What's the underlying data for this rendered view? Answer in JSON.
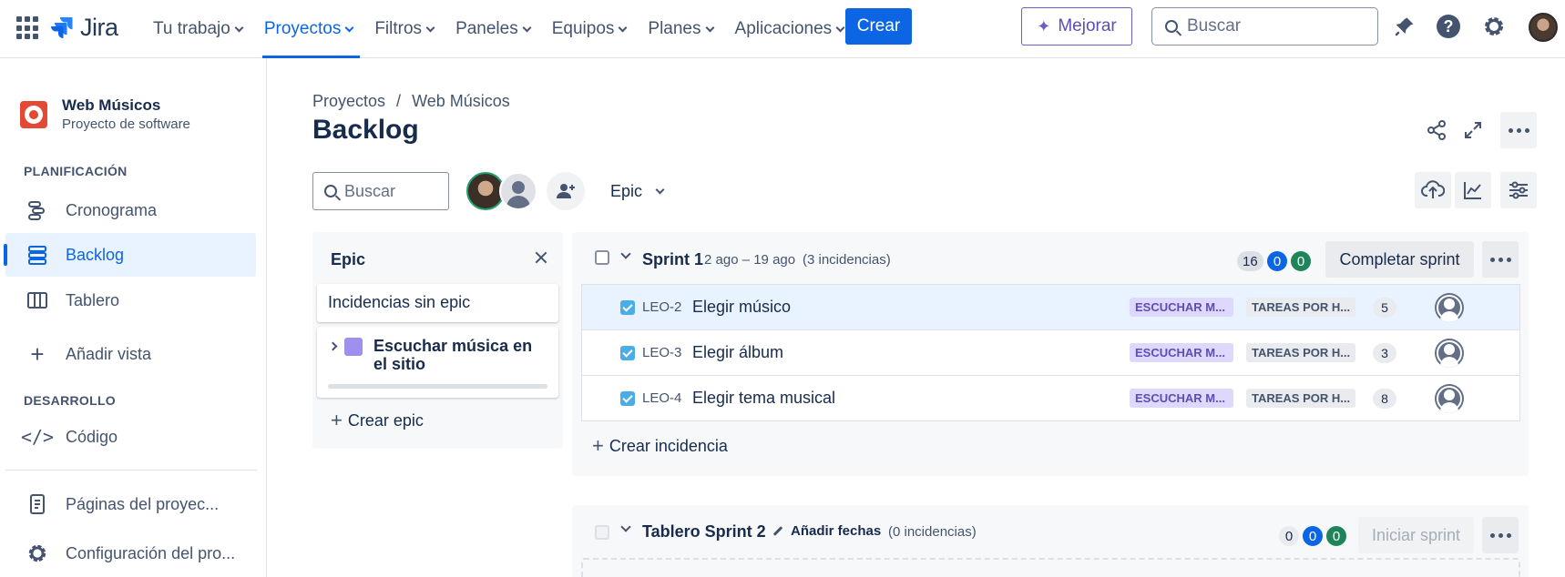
{
  "topnav": {
    "logo": "Jira",
    "items": [
      {
        "label": "Tu trabajo"
      },
      {
        "label": "Proyectos"
      },
      {
        "label": "Filtros"
      },
      {
        "label": "Paneles"
      },
      {
        "label": "Equipos"
      },
      {
        "label": "Planes"
      },
      {
        "label": "Aplicaciones"
      }
    ],
    "active_item": "Proyectos",
    "create_label": "Crear",
    "improve_label": "Mejorar",
    "search_placeholder": "Buscar",
    "icons": [
      "notifications-icon",
      "help-icon",
      "settings-icon",
      "avatar"
    ]
  },
  "sidebar": {
    "project_name": "Web Músicos",
    "project_type": "Proyecto de software",
    "planning_heading": "PLANIFICACIÓN",
    "planning_items": [
      {
        "label": "Cronograma",
        "icon": "timeline-icon"
      },
      {
        "label": "Backlog",
        "icon": "backlog-icon"
      },
      {
        "label": "Tablero",
        "icon": "board-icon"
      }
    ],
    "active_item": "Backlog",
    "add_view": "Añadir vista",
    "dev_heading": "DESARROLLO",
    "code_label": "Código",
    "project_pages": "Páginas del proyec...",
    "project_settings": "Configuración del pro..."
  },
  "header": {
    "breadcrumb": [
      "Proyectos",
      "Web Músicos"
    ],
    "breadcrumb_sep": "/",
    "title": "Backlog"
  },
  "toolbar": {
    "search_placeholder": "Buscar",
    "epic_filter": "Epic"
  },
  "epic_panel": {
    "title": "Epic",
    "no_epic": "Incidencias sin epic",
    "epics": [
      {
        "name": "Escuchar música en el sitio",
        "color": "#9f8fef"
      }
    ],
    "create_epic": "Crear epic"
  },
  "sprints": [
    {
      "name": "Sprint 1",
      "dates": "2 ago – 19 ago",
      "count": "(3 incidencias)",
      "points": {
        "todo": "16",
        "in_progress": "0",
        "done": "0"
      },
      "action": "Completar sprint",
      "issues": [
        {
          "key": "LEO-2",
          "summary": "Elegir músico",
          "epic": "ESCUCHAR M...",
          "status": "TAREAS POR H...",
          "points": "5"
        },
        {
          "key": "LEO-3",
          "summary": "Elegir álbum",
          "epic": "ESCUCHAR M...",
          "status": "TAREAS POR H...",
          "points": "3"
        },
        {
          "key": "LEO-4",
          "summary": "Elegir tema musical",
          "epic": "ESCUCHAR M...",
          "status": "TAREAS POR H...",
          "points": "8"
        }
      ],
      "create_issue": "Crear incidencia"
    },
    {
      "name": "Tablero Sprint 2",
      "add_dates": "Añadir fechas",
      "count": "(0 incidencias)",
      "points": {
        "todo": "0",
        "in_progress": "0",
        "done": "0"
      },
      "action": "Iniciar sprint"
    }
  ],
  "colors": {
    "brand_blue": "#0c66e4",
    "epic_lozenge_bg": "#dfd8fd",
    "epic_lozenge_text": "#5e4db2",
    "done_green": "#1f845a"
  }
}
